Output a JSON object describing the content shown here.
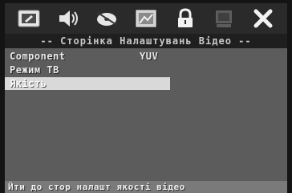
{
  "icons": [
    {
      "name": "general-settings-icon",
      "active": true
    },
    {
      "name": "audio-speaker-icon",
      "active": true
    },
    {
      "name": "video-disc-icon",
      "active": true
    },
    {
      "name": "picture-settings-icon",
      "active": true
    },
    {
      "name": "parental-lock-icon",
      "active": true
    },
    {
      "name": "mp4-settings-icon",
      "active": false
    },
    {
      "name": "exit-x-icon",
      "active": true
    }
  ],
  "header": {
    "title": "-- Сторінка Налаштувань Відео --"
  },
  "menu": {
    "items": [
      {
        "label": "Component",
        "value": "YUV"
      },
      {
        "label": "Режим ТВ",
        "value": ""
      },
      {
        "label": "Якість",
        "value": ""
      }
    ],
    "selected_index": 2
  },
  "footer": {
    "hint": "Йти до стор налашт якості відео"
  },
  "colors": {
    "panel": "#5c5c5c",
    "iconbar": "#2a2a2a",
    "highlight": "#d9d9d9",
    "footer": "#7a7a7a"
  }
}
